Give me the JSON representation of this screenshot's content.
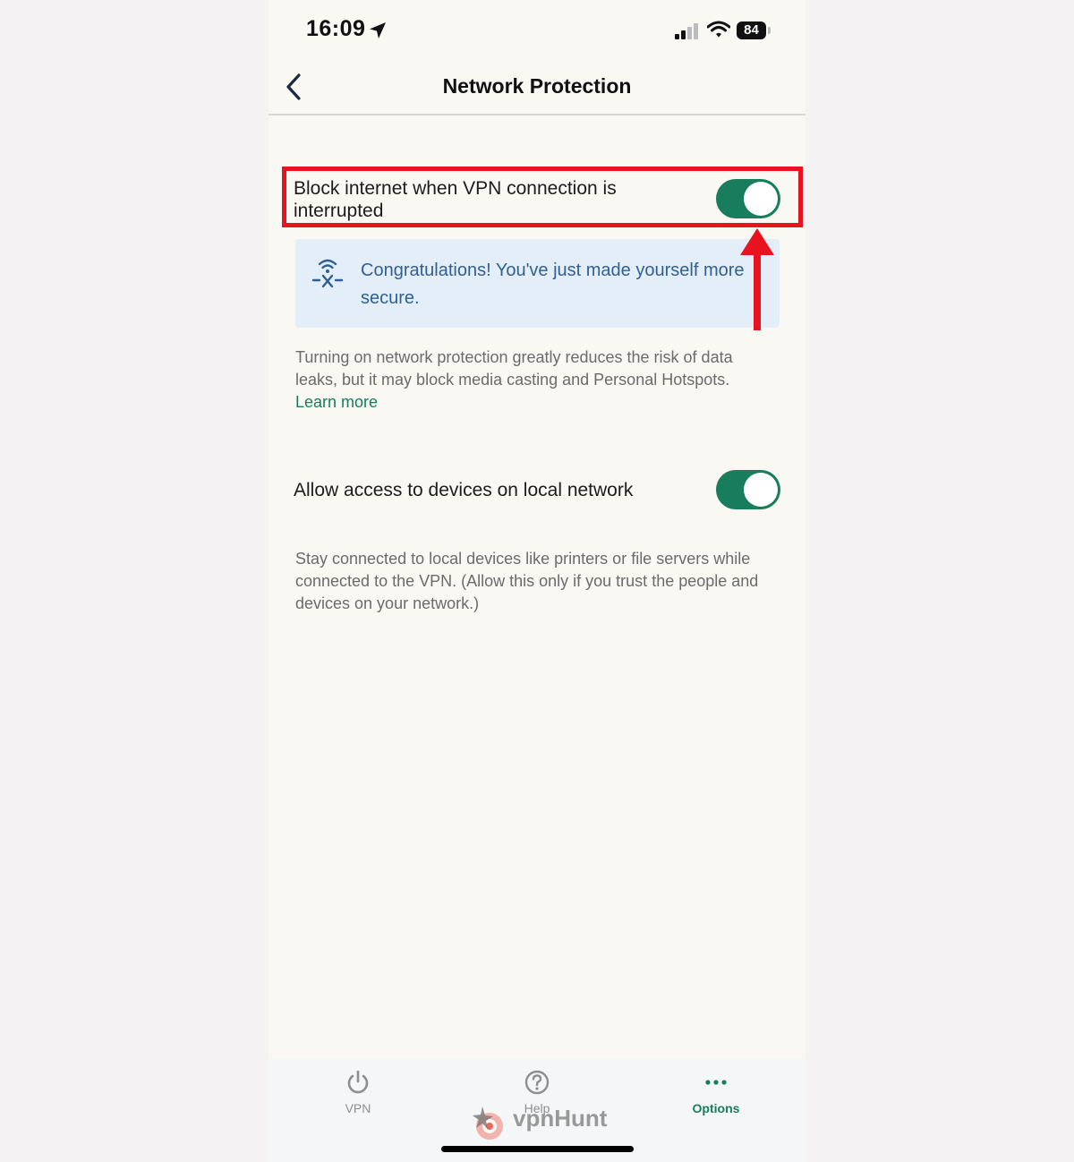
{
  "status_bar": {
    "time": "16:09",
    "battery": "84"
  },
  "header": {
    "title": "Network Protection"
  },
  "settings": [
    {
      "label": "Block internet when VPN connection is interrupted",
      "enabled": true,
      "description": "Turning on network protection greatly reduces the risk of data leaks, but it may block media casting and Personal Hotspots.",
      "link": "Learn more"
    },
    {
      "label": "Allow access to devices on local network",
      "enabled": true,
      "description": "Stay connected to local devices like printers or file servers while connected to the VPN. (Allow this only if you trust the people and devices on your network.)"
    }
  ],
  "notice": {
    "text": "Congratulations! You've just made yourself more secure.",
    "icon": "wifi-shield-icon"
  },
  "tabs": [
    {
      "label": "VPN",
      "icon": "power-icon",
      "active": false
    },
    {
      "label": "Help",
      "icon": "question-icon",
      "active": false
    },
    {
      "label": "Options",
      "icon": "more-dots-icon",
      "active": true
    }
  ],
  "watermark": {
    "text": "vpnHunt"
  },
  "colors": {
    "accent": "#177d5c",
    "highlight": "#e8131f",
    "notice_bg": "#e3eef8",
    "notice_text": "#2f5f93"
  }
}
